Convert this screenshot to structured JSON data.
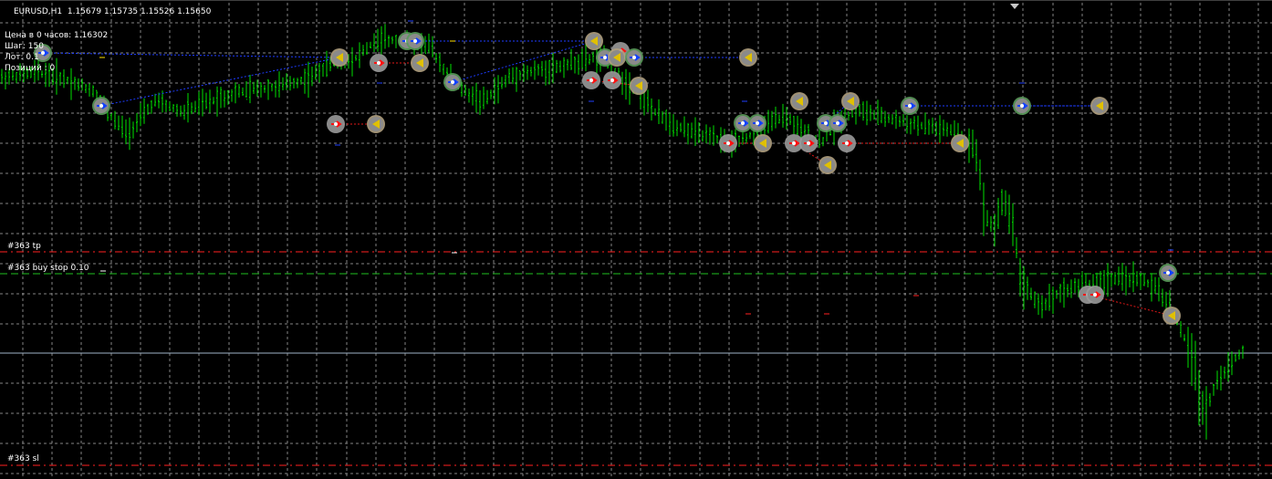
{
  "window": {
    "symbol_timeframe": "EURUSD,H1",
    "ohlc": "1.15679 1.15735 1.15526 1.15650"
  },
  "info_panel": {
    "line1": "Цена в 0 часов: 1.16302",
    "line2": "Шаг: 150",
    "line3": "Лот: 0.1",
    "line4": "Позиций : 0"
  },
  "order_lines": {
    "tp": "#363 tp",
    "buy_stop": "#363 buy stop 0.10",
    "sl": "#363 sl"
  },
  "colors": {
    "background": "#000000",
    "grid": "#b0b0b0",
    "bar": "#00e000",
    "tp_line": "#ff2020",
    "buy_stop_line": "#20c020",
    "sl_line": "#ff2020",
    "bid_line": "#a0b4c8",
    "buy_marker": "#1040ff",
    "sell_marker": "#ff1010",
    "close_marker": "#e0c000",
    "marker_ring": "#a8a8a8"
  },
  "icons": [
    "scroll-position-marker-icon",
    "buy-arrow-icon",
    "sell-arrow-icon",
    "close-triangle-icon"
  ]
}
